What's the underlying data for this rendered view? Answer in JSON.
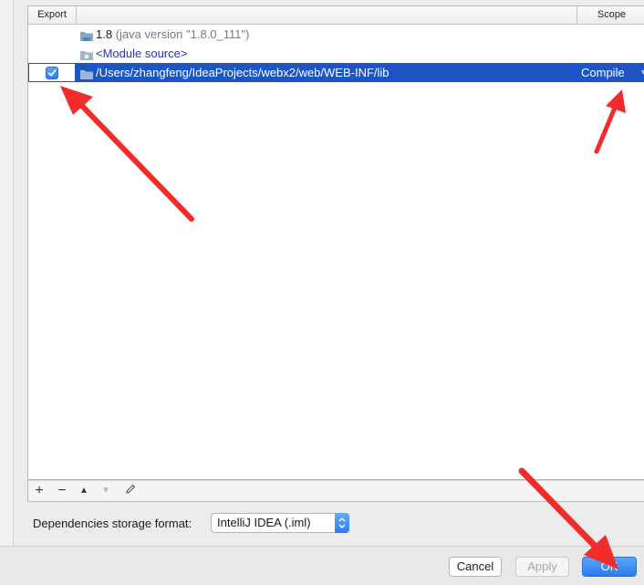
{
  "table": {
    "header_export": "Export",
    "header_scope": "Scope",
    "rows": [
      {
        "name": "1.8",
        "detail": "(java version \"1.8.0_111\")"
      },
      {
        "name": "<Module source>"
      },
      {
        "name": "/Users/zhangfeng/IdeaProjects/webx2/web/WEB-INF/lib",
        "scope": "Compile",
        "exported": true,
        "selected": true
      }
    ]
  },
  "toolbar": {
    "add": "+",
    "remove": "−",
    "up": "▲",
    "down": "▼"
  },
  "storage": {
    "label": "Dependencies storage format:",
    "value": "IntelliJ IDEA (.iml)"
  },
  "buttons": {
    "cancel": "Cancel",
    "apply": "Apply",
    "ok": "OK"
  },
  "colors": {
    "selection": "#1d56c4",
    "accent": "#2a7aef",
    "annotation_arrow": "#f22b2b"
  }
}
